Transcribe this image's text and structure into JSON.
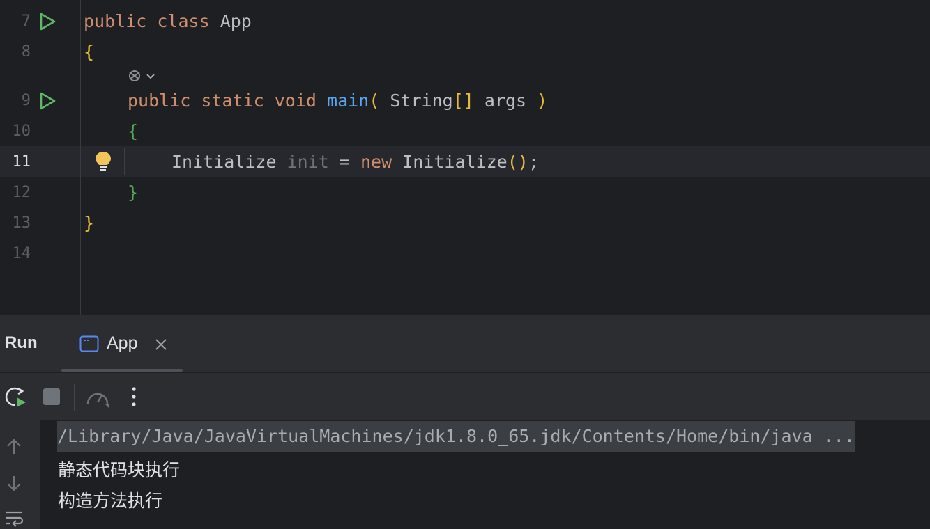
{
  "editor": {
    "line_numbers": [
      "7",
      "8",
      "9",
      "10",
      "11",
      "12",
      "13",
      "14"
    ],
    "lines": {
      "l7": {
        "kw1": "public",
        "kw2": "class",
        "name": "App"
      },
      "l8": {
        "brace": "{"
      },
      "l9": {
        "kw1": "public",
        "kw2": "static",
        "kw3": "void",
        "fn": "main",
        "open": "(",
        "type": "String",
        "arr": "[]",
        "param": "args",
        "close": ")"
      },
      "l10": {
        "brace": "{"
      },
      "l11": {
        "type": "Initialize",
        "var": "init",
        "eq": "=",
        "kw": "new",
        "ctor": "Initialize",
        "parens": "()",
        "semi": ";"
      },
      "l12": {
        "brace": "}"
      },
      "l13": {
        "brace": "}"
      }
    }
  },
  "panel": {
    "title": "Run",
    "tab_label": "App",
    "icons": {
      "rerun": "rerun-icon",
      "stop": "stop-icon",
      "profile": "profiler-icon",
      "more": "more-options-icon"
    }
  },
  "console": {
    "path_line": "/Library/Java/JavaVirtualMachines/jdk1.8.0_65.jdk/Contents/Home/bin/java ...",
    "output": [
      "静态代码块执行",
      "构造方法执行"
    ]
  },
  "colors": {
    "keyword": "#cf8e6d",
    "function": "#56a8f5",
    "bracket": "#e8ba36",
    "bracket_inner": "#54a857",
    "run_green": "#5fb865"
  }
}
